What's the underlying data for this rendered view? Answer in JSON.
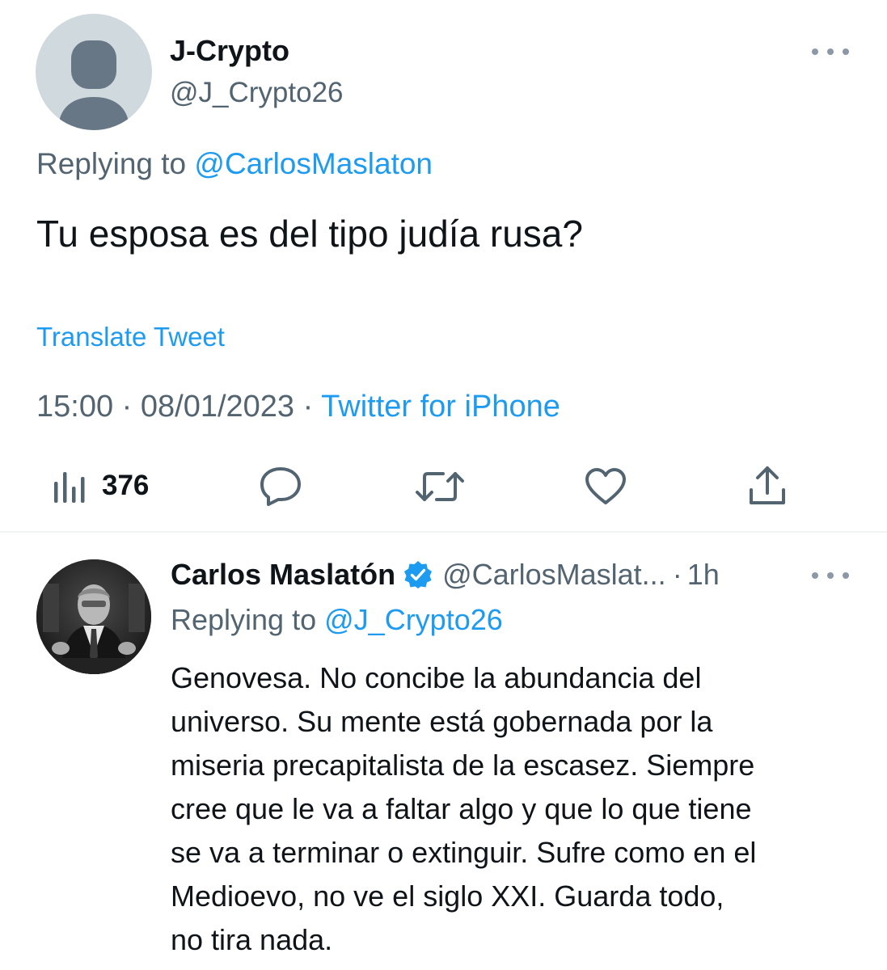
{
  "tweet": {
    "author": {
      "name": "J-Crypto",
      "handle": "@J_Crypto26",
      "avatar": "default-avatar-icon"
    },
    "replying_prefix": "Replying to",
    "replying_handle": "@CarlosMaslaton",
    "text": "Tu esposa es del tipo judía rusa?",
    "translate_label": "Translate Tweet",
    "time": "15:00",
    "separator": "·",
    "date": "08/01/2023",
    "source": "Twitter for iPhone",
    "views": "376",
    "actions": [
      "analytics-icon",
      "reply-icon",
      "retweet-icon",
      "like-icon",
      "share-icon"
    ]
  },
  "reply": {
    "author": {
      "name": "Carlos Maslatón",
      "verified": true,
      "handle": "@CarlosMaslat...",
      "separator": "·",
      "time": "1h"
    },
    "replying_prefix": "Replying to",
    "replying_handle": "@J_Crypto26",
    "text_lines": [
      "Genovesa. No concibe la abundancia del",
      "universo. Su mente está gobernada por la",
      "miseria precapitalista de la escasez. Siempre",
      "cree que le va a faltar algo y que lo que tiene",
      "se va a terminar o extinguir. Sufre como en el",
      "Medioevo, no ve el siglo XXI. Guarda todo,",
      "no tira nada."
    ]
  },
  "colors": {
    "text": "#0f1419",
    "secondary": "#536471",
    "accent": "#1d9bf0",
    "divider": "#eff3f4"
  }
}
